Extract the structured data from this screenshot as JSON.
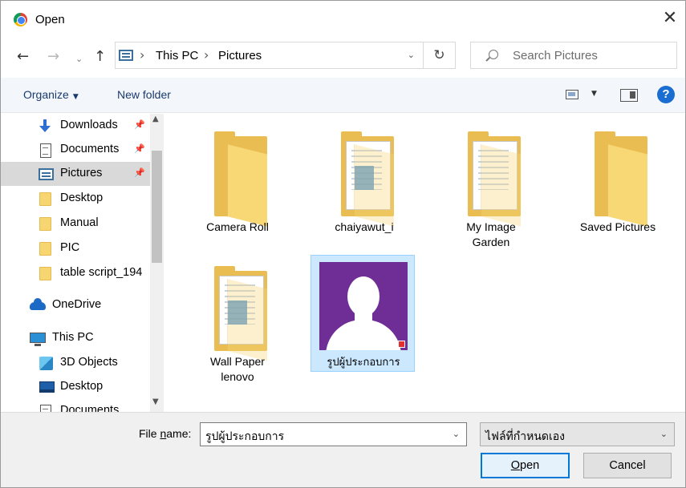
{
  "window": {
    "title": "Open",
    "close_glyph": "✕",
    "app_icon": "chrome-icon"
  },
  "nav": {
    "back_glyph": "←",
    "forward_glyph": "→",
    "recent_glyph": "⌄",
    "up_glyph": "↑",
    "breadcrumb": [
      "This PC",
      "Pictures"
    ],
    "separator": "›",
    "dropdown_glyph": "⌄",
    "refresh_glyph": "↻",
    "search_placeholder": "Search Pictures"
  },
  "toolbar": {
    "organize_label": "Organize",
    "organize_caret": "▼",
    "new_folder_label": "New folder",
    "view_caret": "▼",
    "help_label": "?"
  },
  "sidebar": {
    "pin_glyph": "📌",
    "scroll_up": "▲",
    "scroll_down": "▼",
    "items": [
      {
        "label": "Downloads",
        "icon": "download-icon",
        "pinned": true
      },
      {
        "label": "Documents",
        "icon": "document-icon",
        "pinned": true
      },
      {
        "label": "Pictures",
        "icon": "pictures-icon",
        "pinned": true,
        "selected": true
      },
      {
        "label": "Desktop",
        "icon": "folder-icon"
      },
      {
        "label": "Manual",
        "icon": "folder-icon"
      },
      {
        "label": "PIC",
        "icon": "folder-icon"
      },
      {
        "label": "table script_194",
        "icon": "folder-icon"
      },
      {
        "label": "OneDrive",
        "icon": "onedrive-icon"
      },
      {
        "label": "This PC",
        "icon": "this-pc-icon"
      },
      {
        "label": "3D Objects",
        "icon": "3d-objects-icon"
      },
      {
        "label": "Desktop",
        "icon": "desktop-icon"
      },
      {
        "label": "Documents",
        "icon": "document-icon"
      }
    ]
  },
  "content": {
    "items": [
      {
        "label": "Camera Roll",
        "type": "folder"
      },
      {
        "label": "chaiyawut_i",
        "type": "folder-with-files"
      },
      {
        "label": "My Image\nGarden",
        "type": "folder-with-files"
      },
      {
        "label": "Saved Pictures",
        "type": "folder"
      },
      {
        "label": "Wall Paper\nlenovo",
        "type": "folder-with-files"
      },
      {
        "label": "รูปผู้ประกอบการ",
        "type": "image",
        "selected": true
      }
    ]
  },
  "footer": {
    "file_name_label_prefix": "File ",
    "file_name_label_underlined": "n",
    "file_name_label_suffix": "ame:",
    "file_name_value": "รูปผู้ประกอบการ",
    "file_type_value": "ไฟล์ที่กำหนดเอง",
    "dropdown_glyph": "⌄",
    "open_underlined": "O",
    "open_rest": "pen",
    "cancel_label": "Cancel"
  },
  "colors": {
    "accent": "#0078d7",
    "selection": "#cce8ff",
    "folder": "#f8d775",
    "thumbnail_bg": "#6f2d96",
    "help": "#1a6dd1"
  }
}
